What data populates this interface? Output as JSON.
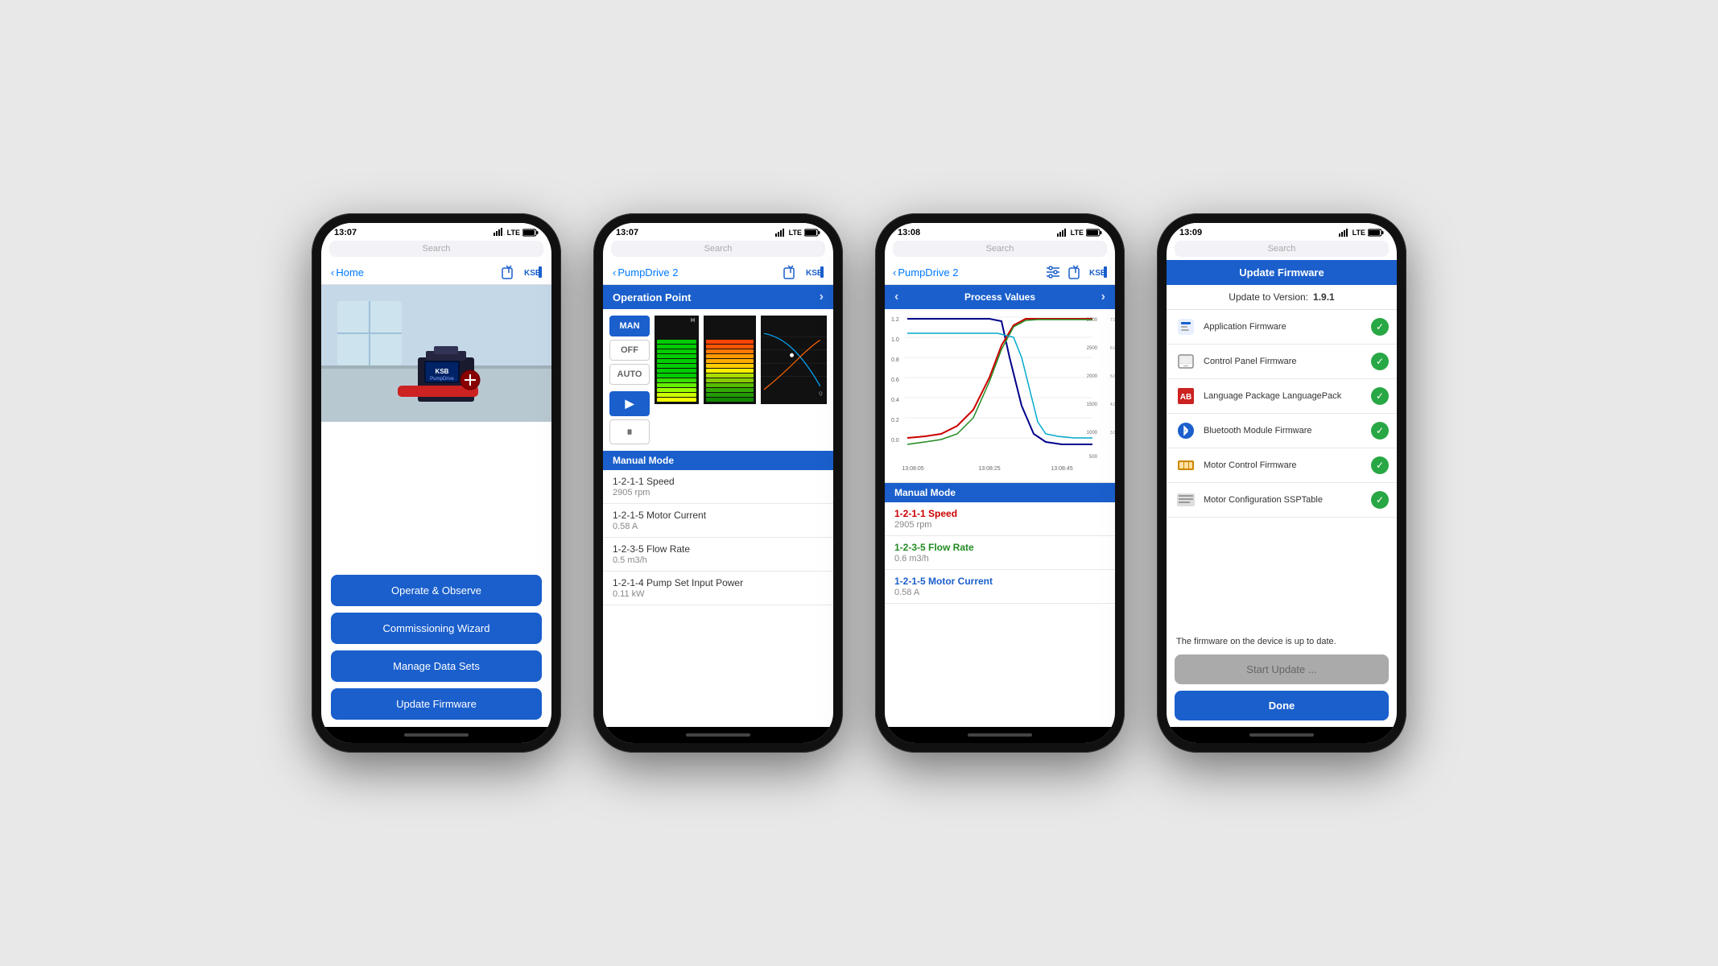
{
  "scene": {
    "background": "#e8e8e8"
  },
  "phones": [
    {
      "id": "phone1",
      "statusBar": {
        "time": "13:07",
        "signal": "LTE",
        "battery": "■"
      },
      "searchBar": "Search",
      "nav": {
        "backLabel": "Home",
        "backIcon": "chevron-left"
      },
      "heroAlt": "KSB PumpDrive industrial pump in modern building lobby",
      "buttons": [
        {
          "label": "Operate & Observe",
          "id": "operate-observe"
        },
        {
          "label": "Commissioning Wizard",
          "id": "commissioning-wizard"
        },
        {
          "label": "Manage Data Sets",
          "id": "manage-data-sets"
        },
        {
          "label": "Update Firmware",
          "id": "update-firmware"
        }
      ]
    },
    {
      "id": "phone2",
      "statusBar": {
        "time": "13:07",
        "signal": "LTE",
        "battery": "■"
      },
      "searchBar": "Search",
      "nav": {
        "backLabel": "PumpDrive 2",
        "backIcon": "chevron-left"
      },
      "operationPoint": {
        "header": "Operation Point",
        "mode": "MAN",
        "buttons": [
          "MAN",
          "OFF",
          "AUTO"
        ],
        "modeLabel": "Manual Mode"
      },
      "params": [
        {
          "name": "1-2-1-1 Speed",
          "value": "2905 rpm"
        },
        {
          "name": "1-2-1-5 Motor Current",
          "value": "0.58 A"
        },
        {
          "name": "1-2-3-5 Flow Rate",
          "value": "0.5 m3/h"
        },
        {
          "name": "1-2-1-4 Pump Set Input Power",
          "value": "0.11 kW"
        }
      ]
    },
    {
      "id": "phone3",
      "statusBar": {
        "time": "13:08",
        "signal": "LTE",
        "battery": "■"
      },
      "searchBar": "Search",
      "nav": {
        "backLabel": "PumpDrive 2",
        "backIcon": "chevron-left"
      },
      "processValues": {
        "header": "Process Values",
        "modeLabel": "Manual Mode"
      },
      "params": [
        {
          "name": "1-2-1-1 Speed",
          "value": "2905 rpm",
          "color": "red"
        },
        {
          "name": "1-2-3-5 Flow Rate",
          "value": "0.6 m3/h",
          "color": "green"
        },
        {
          "name": "1-2-1-5 Motor Current",
          "value": "0.58 A",
          "color": "blue-text"
        }
      ],
      "chart": {
        "xLabels": [
          "13:08:05",
          "13:08:25",
          "13:08:45"
        ],
        "lines": [
          "dark-blue",
          "red",
          "green",
          "cyan"
        ]
      }
    },
    {
      "id": "phone4",
      "statusBar": {
        "time": "13:09",
        "signal": "LTE",
        "battery": "■"
      },
      "searchBar": "Search",
      "firmware": {
        "header": "Update Firmware",
        "versionLabel": "Update to Version:",
        "versionValue": "1.9.1",
        "items": [
          {
            "label": "Application Firmware",
            "icon": "app-fw-icon",
            "checked": true
          },
          {
            "label": "Control Panel Firmware",
            "icon": "control-panel-icon",
            "checked": true
          },
          {
            "label": "Language Package LanguagePack",
            "icon": "language-pkg-icon",
            "checked": true
          },
          {
            "label": "Bluetooth Module Firmware",
            "icon": "bluetooth-icon",
            "checked": true
          },
          {
            "label": "Motor Control Firmware",
            "icon": "motor-ctrl-icon",
            "checked": true
          },
          {
            "label": "Motor Configuration SSPTable",
            "icon": "motor-config-icon",
            "checked": true
          }
        ],
        "statusText": "The firmware on the device is up to date.",
        "startBtn": "Start Update ...",
        "doneBtn": "Done"
      }
    }
  ]
}
